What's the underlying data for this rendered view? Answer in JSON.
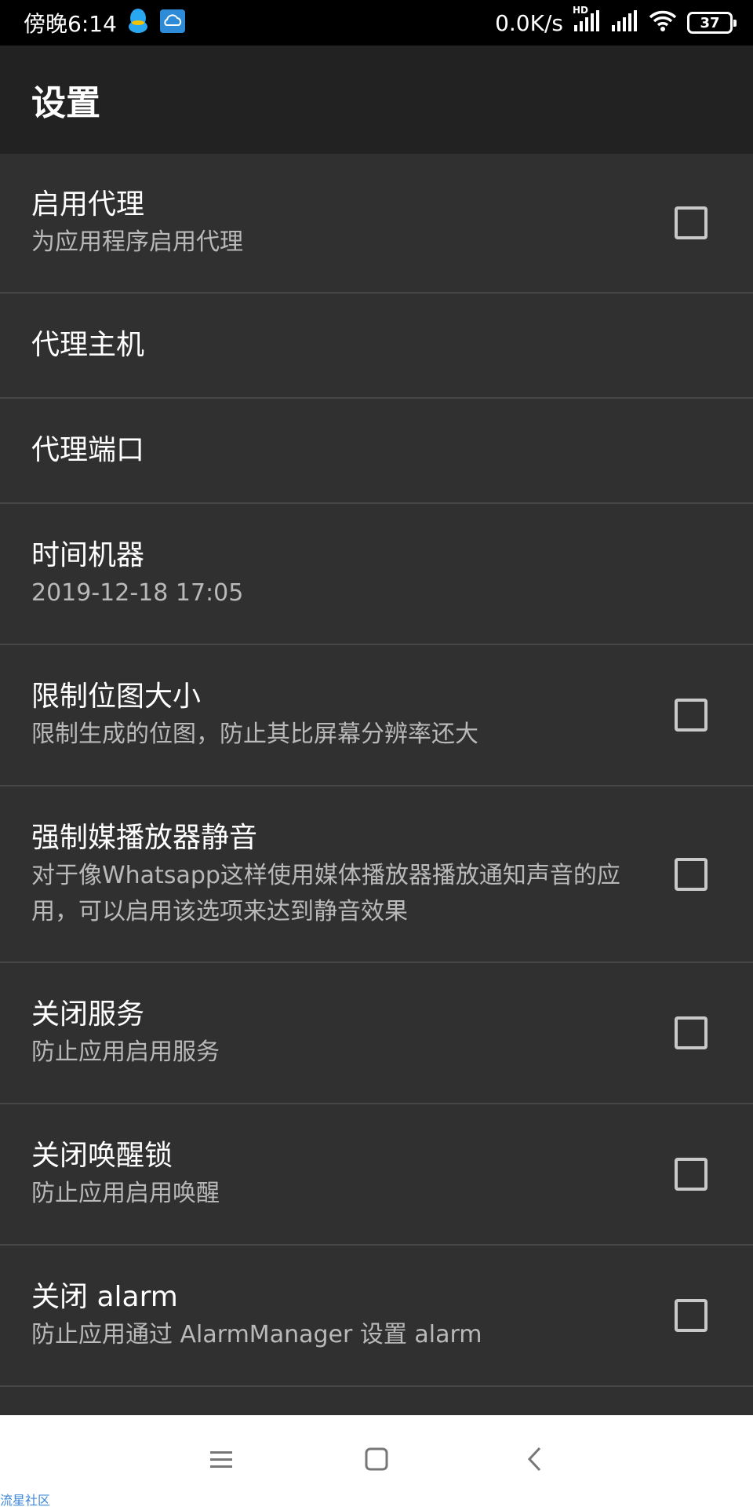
{
  "status_bar": {
    "time": "傍晚6:14",
    "net_speed": "0.0K/s",
    "network_badge": "HD",
    "battery": "37",
    "icons": [
      "qq-icon",
      "cloud-icon",
      "signal-icon",
      "signal-icon-2",
      "wifi-icon",
      "battery-icon"
    ]
  },
  "app_bar": {
    "title": "设置"
  },
  "settings": [
    {
      "title": "启用代理",
      "subtitle": "为应用程序启用代理",
      "checkbox": true,
      "checked": false
    },
    {
      "title": "代理主机",
      "subtitle": "",
      "checkbox": false
    },
    {
      "title": "代理端口",
      "subtitle": "",
      "checkbox": false
    },
    {
      "title": "时间机器",
      "subtitle": "2019-12-18 17:05",
      "checkbox": false
    },
    {
      "title": "限制位图大小",
      "subtitle": "限制生成的位图，防止其比屏幕分辨率还大",
      "checkbox": true,
      "checked": false
    },
    {
      "title": "强制媒播放器静音",
      "subtitle": "对于像Whatsapp这样使用媒体播放器播放通知声音的应用，可以启用该选项来达到静音效果",
      "checkbox": true,
      "checked": false
    },
    {
      "title": "关闭服务",
      "subtitle": "防止应用启用服务",
      "checkbox": true,
      "checked": false
    },
    {
      "title": "关闭唤醒锁",
      "subtitle": "防止应用启用唤醒",
      "checkbox": true,
      "checked": false
    },
    {
      "title": "关闭 alarm",
      "subtitle": "防止应用通过 AlarmManager 设置 alarm",
      "checkbox": true,
      "checked": false
    }
  ],
  "nav_bar": {
    "icons": [
      "menu-icon",
      "home-icon",
      "back-icon"
    ]
  },
  "watermark": "流星社区"
}
